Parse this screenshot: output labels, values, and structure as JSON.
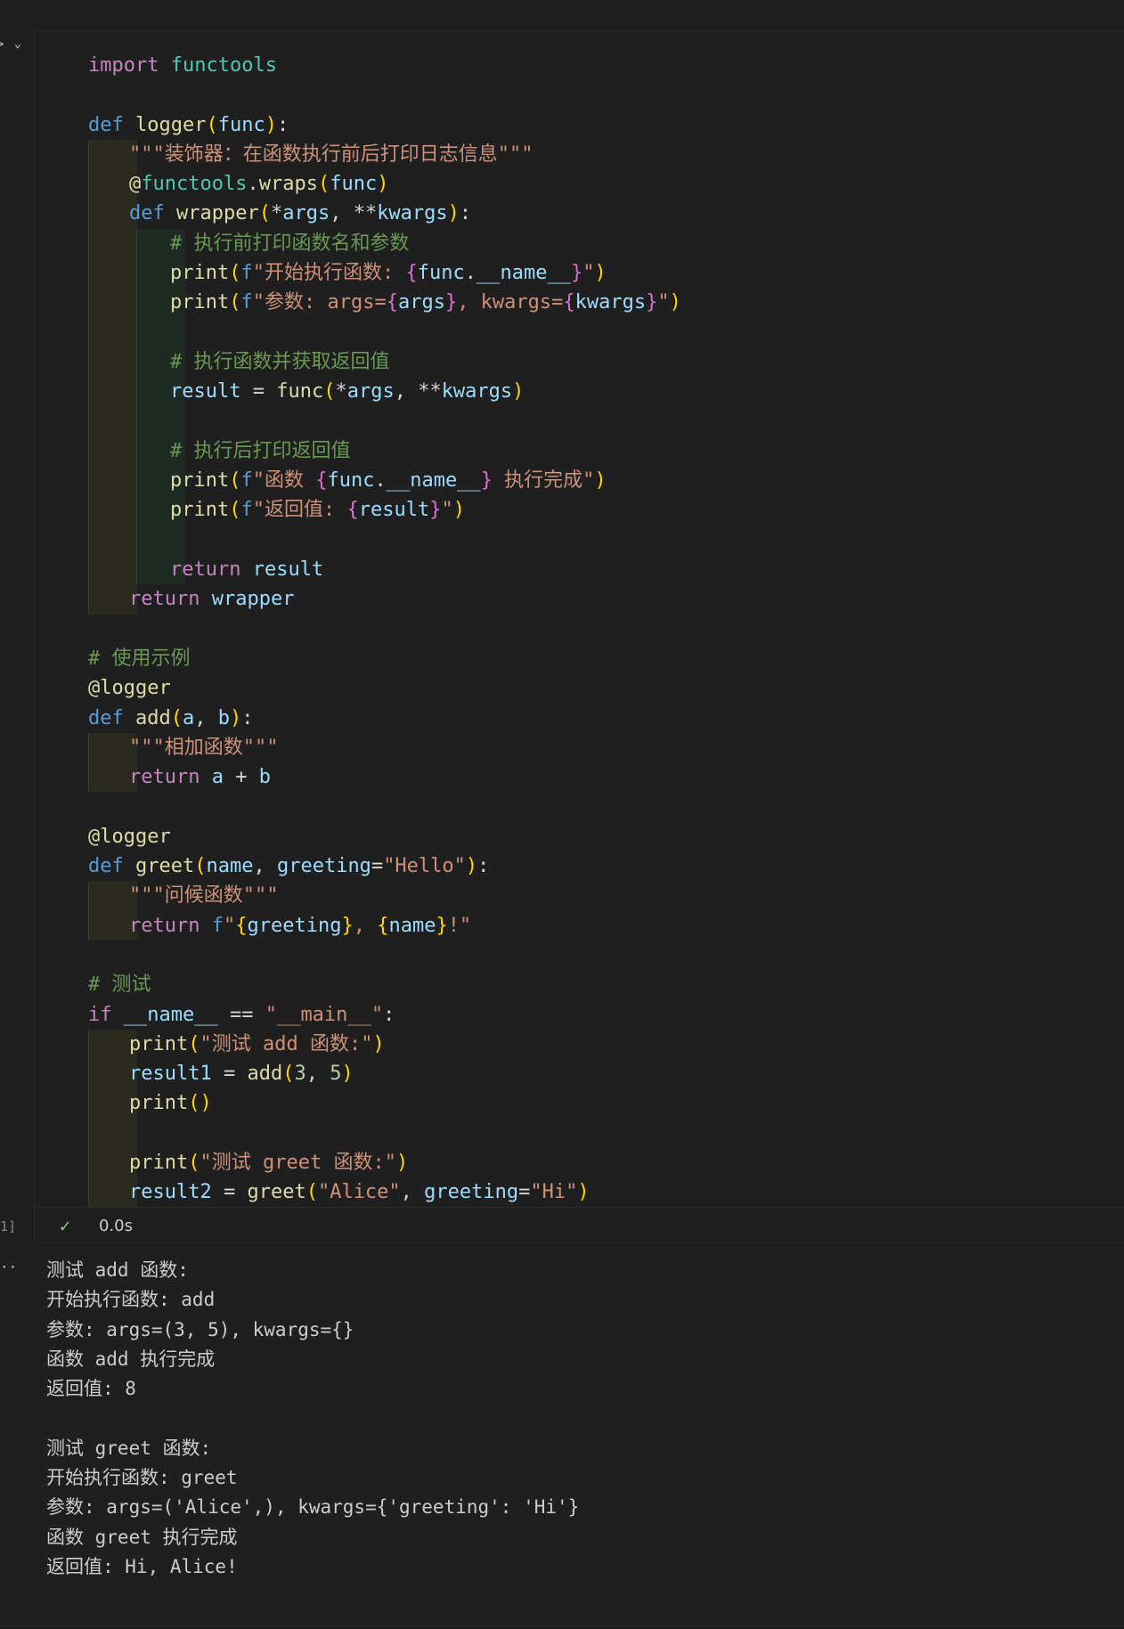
{
  "cell": {
    "execution_count": "1]",
    "status_time": "0.0s",
    "code_lines": [
      {
        "indent": 0,
        "tokens": [
          [
            "k-import",
            "import"
          ],
          [
            "op",
            " "
          ],
          [
            "mod",
            "functools"
          ]
        ]
      },
      {
        "indent": 0,
        "tokens": []
      },
      {
        "indent": 0,
        "tokens": [
          [
            "k-def",
            "def"
          ],
          [
            "op",
            " "
          ],
          [
            "fn",
            "logger"
          ],
          [
            "p1",
            "("
          ],
          [
            "var",
            "func"
          ],
          [
            "p1",
            ")"
          ],
          [
            "op",
            ":"
          ]
        ]
      },
      {
        "indent": 1,
        "tokens": [
          [
            "str",
            "\"\"\"装饰器：在函数执行前后打印日志信息\"\"\""
          ]
        ]
      },
      {
        "indent": 1,
        "tokens": [
          [
            "fn",
            "@"
          ],
          [
            "mod",
            "functools"
          ],
          [
            "op",
            "."
          ],
          [
            "fn",
            "wraps"
          ],
          [
            "p1",
            "("
          ],
          [
            "var",
            "func"
          ],
          [
            "p1",
            ")"
          ]
        ]
      },
      {
        "indent": 1,
        "tokens": [
          [
            "k-def",
            "def"
          ],
          [
            "op",
            " "
          ],
          [
            "fn",
            "wrapper"
          ],
          [
            "p1",
            "("
          ],
          [
            "op",
            "*"
          ],
          [
            "var",
            "args"
          ],
          [
            "op",
            ", **"
          ],
          [
            "var",
            "kwargs"
          ],
          [
            "p1",
            ")"
          ],
          [
            "op",
            ":"
          ]
        ]
      },
      {
        "indent": 2,
        "tokens": [
          [
            "cmt",
            "# 执行前打印函数名和参数"
          ]
        ]
      },
      {
        "indent": 2,
        "tokens": [
          [
            "fn",
            "print"
          ],
          [
            "p1",
            "("
          ],
          [
            "k-def",
            "f"
          ],
          [
            "str",
            "\"开始执行函数: "
          ],
          [
            "p2",
            "{"
          ],
          [
            "var",
            "func"
          ],
          [
            "op",
            "."
          ],
          [
            "var",
            "__name__"
          ],
          [
            "p2",
            "}"
          ],
          [
            "str",
            "\""
          ],
          [
            "p1",
            ")"
          ]
        ]
      },
      {
        "indent": 2,
        "tokens": [
          [
            "fn",
            "print"
          ],
          [
            "p1",
            "("
          ],
          [
            "k-def",
            "f"
          ],
          [
            "str",
            "\"参数: args="
          ],
          [
            "p2",
            "{"
          ],
          [
            "var",
            "args"
          ],
          [
            "p2",
            "}"
          ],
          [
            "str",
            ", kwargs="
          ],
          [
            "p2",
            "{"
          ],
          [
            "var",
            "kwargs"
          ],
          [
            "p2",
            "}"
          ],
          [
            "str",
            "\""
          ],
          [
            "p1",
            ")"
          ]
        ]
      },
      {
        "indent": 2,
        "tokens": []
      },
      {
        "indent": 2,
        "tokens": [
          [
            "cmt",
            "# 执行函数并获取返回值"
          ]
        ]
      },
      {
        "indent": 2,
        "tokens": [
          [
            "var",
            "result"
          ],
          [
            "op",
            " = "
          ],
          [
            "fn",
            "func"
          ],
          [
            "p1",
            "("
          ],
          [
            "op",
            "*"
          ],
          [
            "var",
            "args"
          ],
          [
            "op",
            ", **"
          ],
          [
            "var",
            "kwargs"
          ],
          [
            "p1",
            ")"
          ]
        ]
      },
      {
        "indent": 2,
        "tokens": []
      },
      {
        "indent": 2,
        "tokens": [
          [
            "cmt",
            "# 执行后打印返回值"
          ]
        ]
      },
      {
        "indent": 2,
        "tokens": [
          [
            "fn",
            "print"
          ],
          [
            "p1",
            "("
          ],
          [
            "k-def",
            "f"
          ],
          [
            "str",
            "\"函数 "
          ],
          [
            "p2",
            "{"
          ],
          [
            "var",
            "func"
          ],
          [
            "op",
            "."
          ],
          [
            "var",
            "__name__"
          ],
          [
            "p2",
            "}"
          ],
          [
            "str",
            " 执行完成\""
          ],
          [
            "p1",
            ")"
          ]
        ]
      },
      {
        "indent": 2,
        "tokens": [
          [
            "fn",
            "print"
          ],
          [
            "p1",
            "("
          ],
          [
            "k-def",
            "f"
          ],
          [
            "str",
            "\"返回值: "
          ],
          [
            "p2",
            "{"
          ],
          [
            "var",
            "result"
          ],
          [
            "p2",
            "}"
          ],
          [
            "str",
            "\""
          ],
          [
            "p1",
            ")"
          ]
        ]
      },
      {
        "indent": 2,
        "tokens": []
      },
      {
        "indent": 2,
        "tokens": [
          [
            "k-ret",
            "return"
          ],
          [
            "op",
            " "
          ],
          [
            "var",
            "result"
          ]
        ]
      },
      {
        "indent": 1,
        "tokens": [
          [
            "k-ret",
            "return"
          ],
          [
            "op",
            " "
          ],
          [
            "var",
            "wrapper"
          ]
        ]
      },
      {
        "indent": 0,
        "tokens": []
      },
      {
        "indent": 0,
        "tokens": [
          [
            "cmt",
            "# 使用示例"
          ]
        ]
      },
      {
        "indent": 0,
        "tokens": [
          [
            "fn",
            "@logger"
          ]
        ]
      },
      {
        "indent": 0,
        "tokens": [
          [
            "k-def",
            "def"
          ],
          [
            "op",
            " "
          ],
          [
            "fn",
            "add"
          ],
          [
            "p1",
            "("
          ],
          [
            "var",
            "a"
          ],
          [
            "op",
            ", "
          ],
          [
            "var",
            "b"
          ],
          [
            "p1",
            ")"
          ],
          [
            "op",
            ":"
          ]
        ]
      },
      {
        "indent": 1,
        "tokens": [
          [
            "str",
            "\"\"\"相加函数\"\"\""
          ]
        ]
      },
      {
        "indent": 1,
        "tokens": [
          [
            "k-ret",
            "return"
          ],
          [
            "op",
            " "
          ],
          [
            "var",
            "a"
          ],
          [
            "op",
            " + "
          ],
          [
            "var",
            "b"
          ]
        ]
      },
      {
        "indent": 0,
        "tokens": []
      },
      {
        "indent": 0,
        "tokens": [
          [
            "fn",
            "@logger"
          ]
        ]
      },
      {
        "indent": 0,
        "tokens": [
          [
            "k-def",
            "def"
          ],
          [
            "op",
            " "
          ],
          [
            "fn",
            "greet"
          ],
          [
            "p1",
            "("
          ],
          [
            "var",
            "name"
          ],
          [
            "op",
            ", "
          ],
          [
            "var",
            "greeting"
          ],
          [
            "op",
            "="
          ],
          [
            "str",
            "\"Hello\""
          ],
          [
            "p1",
            ")"
          ],
          [
            "op",
            ":"
          ]
        ]
      },
      {
        "indent": 1,
        "tokens": [
          [
            "str",
            "\"\"\"问候函数\"\"\""
          ]
        ]
      },
      {
        "indent": 1,
        "tokens": [
          [
            "k-ret",
            "return"
          ],
          [
            "op",
            " "
          ],
          [
            "k-def",
            "f"
          ],
          [
            "str",
            "\""
          ],
          [
            "p1",
            "{"
          ],
          [
            "var",
            "greeting"
          ],
          [
            "p1",
            "}"
          ],
          [
            "str",
            ", "
          ],
          [
            "p1",
            "{"
          ],
          [
            "var",
            "name"
          ],
          [
            "p1",
            "}"
          ],
          [
            "str",
            "!\""
          ]
        ]
      },
      {
        "indent": 0,
        "tokens": []
      },
      {
        "indent": 0,
        "tokens": [
          [
            "cmt",
            "# 测试"
          ]
        ]
      },
      {
        "indent": 0,
        "tokens": [
          [
            "k-ret",
            "if"
          ],
          [
            "op",
            " "
          ],
          [
            "var",
            "__name__"
          ],
          [
            "op",
            " == "
          ],
          [
            "str",
            "\"__main__\""
          ],
          [
            "op",
            ":"
          ]
        ]
      },
      {
        "indent": 1,
        "tokens": [
          [
            "fn",
            "print"
          ],
          [
            "p1",
            "("
          ],
          [
            "str",
            "\"测试 add 函数:\""
          ],
          [
            "p1",
            ")"
          ]
        ]
      },
      {
        "indent": 1,
        "tokens": [
          [
            "var",
            "result1"
          ],
          [
            "op",
            " = "
          ],
          [
            "fn",
            "add"
          ],
          [
            "p1",
            "("
          ],
          [
            "num",
            "3"
          ],
          [
            "op",
            ", "
          ],
          [
            "num",
            "5"
          ],
          [
            "p1",
            ")"
          ]
        ]
      },
      {
        "indent": 1,
        "tokens": [
          [
            "fn",
            "print"
          ],
          [
            "p1",
            "()"
          ]
        ]
      },
      {
        "indent": 1,
        "tokens": []
      },
      {
        "indent": 1,
        "tokens": [
          [
            "fn",
            "print"
          ],
          [
            "p1",
            "("
          ],
          [
            "str",
            "\"测试 greet 函数:\""
          ],
          [
            "p1",
            ")"
          ]
        ]
      },
      {
        "indent": 1,
        "tokens": [
          [
            "var",
            "result2"
          ],
          [
            "op",
            " = "
          ],
          [
            "fn",
            "greet"
          ],
          [
            "p1",
            "("
          ],
          [
            "str",
            "\"Alice\""
          ],
          [
            "op",
            ", "
          ],
          [
            "var",
            "greeting"
          ],
          [
            "op",
            "="
          ],
          [
            "str",
            "\"Hi\""
          ],
          [
            "p1",
            ")"
          ]
        ]
      }
    ]
  },
  "output": {
    "lines": [
      "测试 add 函数:",
      "开始执行函数: add",
      "参数: args=(3, 5), kwargs={}",
      "函数 add 执行完成",
      "返回值: 8",
      "",
      "测试 greet 函数:",
      "开始执行函数: greet",
      "参数: args=('Alice',), kwargs={'greeting': 'Hi'}",
      "函数 greet 执行完成",
      "返回值: Hi, Alice!"
    ]
  },
  "icons": {
    "run": "run-icon",
    "collapse": "chevron-down-icon",
    "success": "check-icon",
    "output_menu": "ellipsis-icon"
  }
}
